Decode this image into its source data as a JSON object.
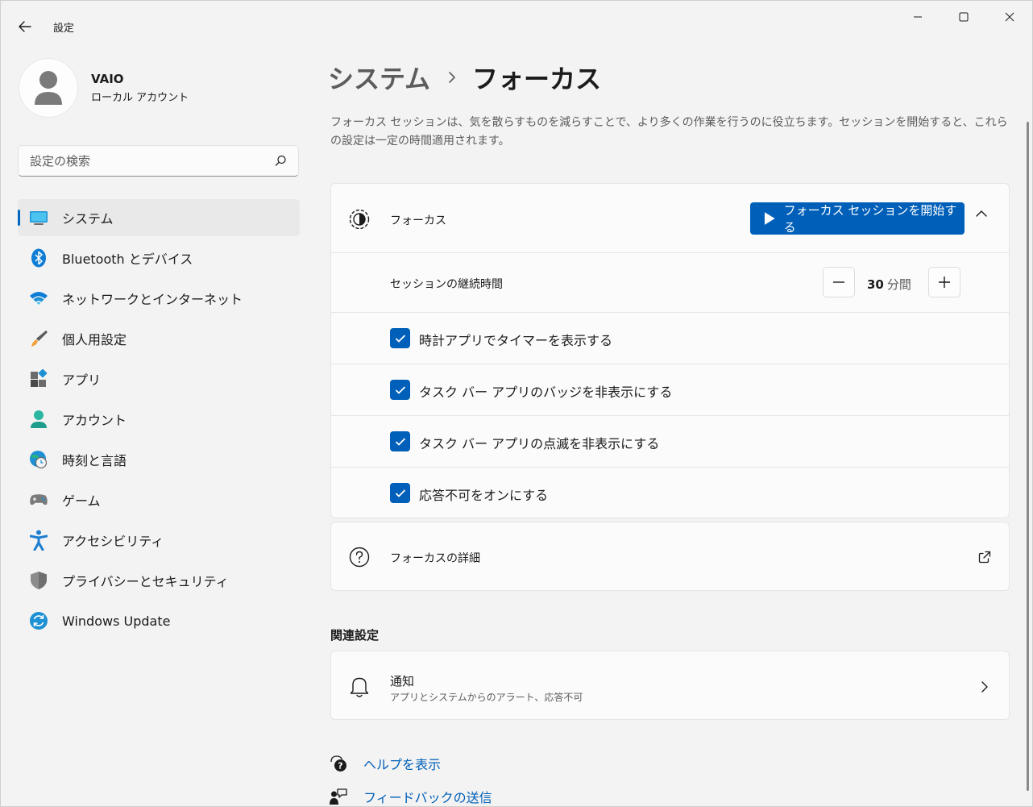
{
  "window": {
    "title": "設定",
    "back_icon": "arrow-left-icon",
    "controls": [
      "minimize-icon",
      "maximize-icon",
      "close-icon"
    ]
  },
  "profile": {
    "name": "VAIO",
    "account_type": "ローカル アカウント"
  },
  "search": {
    "placeholder": "設定の検索",
    "value": ""
  },
  "sidebar": {
    "items": [
      {
        "label": "システム",
        "icon": "monitor-icon",
        "active": true
      },
      {
        "label": "Bluetooth とデバイス",
        "icon": "bluetooth-icon",
        "active": false
      },
      {
        "label": "ネットワークとインターネット",
        "icon": "wifi-icon",
        "active": false
      },
      {
        "label": "個人用設定",
        "icon": "paintbrush-icon",
        "active": false
      },
      {
        "label": "アプリ",
        "icon": "apps-icon",
        "active": false
      },
      {
        "label": "アカウント",
        "icon": "person-icon",
        "active": false
      },
      {
        "label": "時刻と言語",
        "icon": "globe-clock-icon",
        "active": false
      },
      {
        "label": "ゲーム",
        "icon": "gamepad-icon",
        "active": false
      },
      {
        "label": "アクセシビリティ",
        "icon": "accessibility-icon",
        "active": false
      },
      {
        "label": "プライバシーとセキュリティ",
        "icon": "shield-icon",
        "active": false
      },
      {
        "label": "Windows Update",
        "icon": "sync-icon",
        "active": false
      }
    ]
  },
  "header": {
    "parent": "システム",
    "current": "フォーカス"
  },
  "description": "フォーカス セッションは、気を散らすものを減らすことで、より多くの作業を行うのに役立ちます。セッションを開始すると、これらの設定は一定の時間適用されます。",
  "focus": {
    "title": "フォーカス",
    "start_button": "フォーカス セッションを開始する",
    "duration_label": "セッションの継続時間",
    "duration_value": "30",
    "duration_unit": "分間",
    "options": [
      {
        "label": "時計アプリでタイマーを表示する",
        "checked": true
      },
      {
        "label": "タスク バー アプリのバッジを非表示にする",
        "checked": true
      },
      {
        "label": "タスク バー アプリの点滅を非表示にする",
        "checked": true
      },
      {
        "label": "応答不可をオンにする",
        "checked": true
      }
    ]
  },
  "details": {
    "title": "フォーカスの詳細"
  },
  "related": {
    "heading": "関連設定",
    "notifications": {
      "title": "通知",
      "subtitle": "アプリとシステムからのアラート、応答不可"
    }
  },
  "links": {
    "help": "ヘルプを表示",
    "feedback": "フィードバックの送信"
  },
  "colors": {
    "accent": "#005fb8",
    "background": "#f3f3f3",
    "card": "#fbfbfb"
  }
}
